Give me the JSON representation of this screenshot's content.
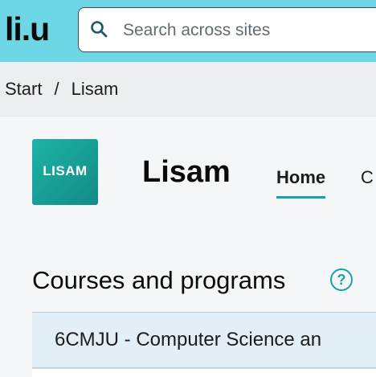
{
  "header": {
    "logo_text": "li.u",
    "search": {
      "placeholder": "Search across sites",
      "value": ""
    },
    "background_color": "#6fd6e6"
  },
  "breadcrumb": {
    "items": [
      "Start",
      "Lisam"
    ],
    "separator": "/"
  },
  "site": {
    "logo_text": "LISAM",
    "title": "Lisam",
    "tabs": [
      {
        "label": "Home",
        "active": true
      },
      {
        "label": "C",
        "active": false
      }
    ],
    "accent_color": "#17a3a3"
  },
  "courses": {
    "title": "Courses and programs",
    "help_icon": "?",
    "items": [
      {
        "label": "6CMJU - Computer Science an"
      }
    ]
  }
}
